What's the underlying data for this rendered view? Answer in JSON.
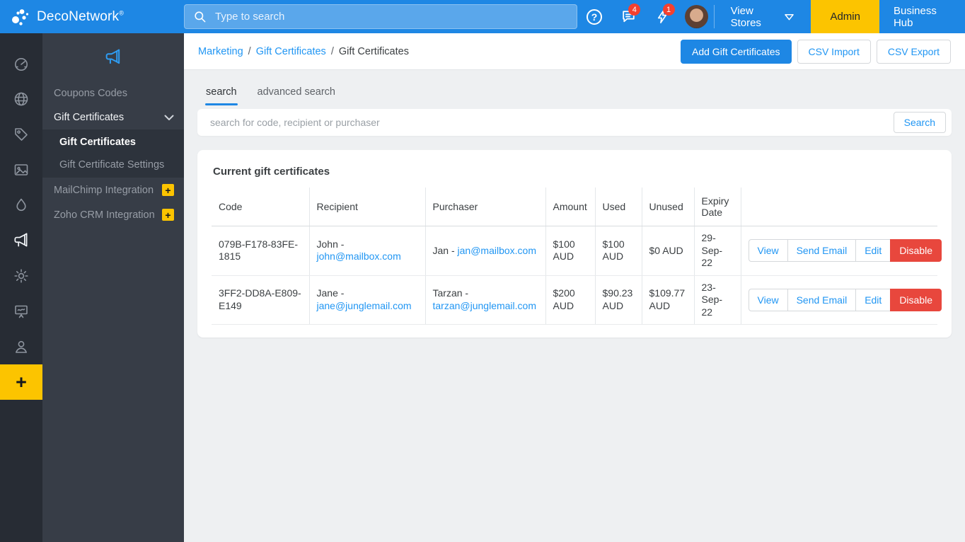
{
  "topbar": {
    "brand": "DecoNetwork",
    "brand_reg": "®",
    "search_placeholder": "Type to search",
    "messages_badge": "4",
    "alerts_badge": "1",
    "help_glyph": "?",
    "view_stores_label": "View Stores",
    "admin_label": "Admin",
    "business_hub_label": "Business Hub"
  },
  "sidebar": {
    "rail_icons": [
      "dashboard-icon",
      "websites-icon",
      "tag-icon",
      "designs-icon",
      "droplet-icon",
      "megaphone-icon",
      "settings-icon",
      "artboard-icon",
      "account-icon"
    ],
    "rail_active_icon": "megaphone-icon",
    "rail_plus_label": "+",
    "panel": {
      "section_icon": "megaphone-icon",
      "items": [
        {
          "label": "Coupons Codes"
        },
        {
          "label": "Gift Certificates",
          "expanded": true
        },
        {
          "label": "Gift Certificates",
          "active": true,
          "child": true
        },
        {
          "label": "Gift Certificate Settings",
          "child": true
        },
        {
          "label": "MailChimp Integration",
          "badge": "+"
        },
        {
          "label": "Zoho CRM Integration",
          "badge": "+"
        }
      ]
    }
  },
  "breadcrumb": {
    "separator": "/",
    "items": [
      "Marketing",
      "Gift Certificates",
      "Gift Certificates"
    ]
  },
  "page_actions": {
    "add": "Add Gift Certificates",
    "csv_import": "CSV Import",
    "csv_export": "CSV Export"
  },
  "tabs": [
    {
      "label": "search",
      "active": true
    },
    {
      "label": "advanced search",
      "active": false
    }
  ],
  "filter": {
    "placeholder": "search for code, recipient or purchaser",
    "button": "Search"
  },
  "table": {
    "title": "Current gift certificates",
    "columns": [
      "Code",
      "Recipient",
      "Purchaser",
      "Amount",
      "Used",
      "Unused",
      "Expiry Date"
    ],
    "row_actions": [
      "View",
      "Send Email",
      "Edit",
      "Disable"
    ],
    "rows": [
      {
        "code": "079B-F178-83FE-1815",
        "recipient_name": "John -",
        "recipient_email": "john@mailbox.com",
        "purchaser_name": "Jan -",
        "purchaser_email": "jan@mailbox.com",
        "amount": "$100 AUD",
        "used": "$100 AUD",
        "unused": "$0 AUD",
        "expiry": "29-Sep-22"
      },
      {
        "code": "3FF2-DD8A-E809-E149",
        "recipient_name": "Jane -",
        "recipient_email": "jane@junglemail.com",
        "purchaser_name": "Tarzan -",
        "purchaser_email": "tarzan@junglemail.com",
        "amount": "$200 AUD",
        "used": "$90.23 AUD",
        "unused": "$109.77 AUD",
        "expiry": "23-Sep-22"
      }
    ]
  },
  "colors": {
    "topbar_blue": "#1e87e4",
    "accent_blue": "#2196f3",
    "admin_yellow": "#fcc400",
    "danger_red": "#e8473d",
    "badge_red": "#f4402f",
    "rail_dark": "#272c34",
    "panel_dark": "#373d47",
    "content_bg": "#eef0f2"
  }
}
